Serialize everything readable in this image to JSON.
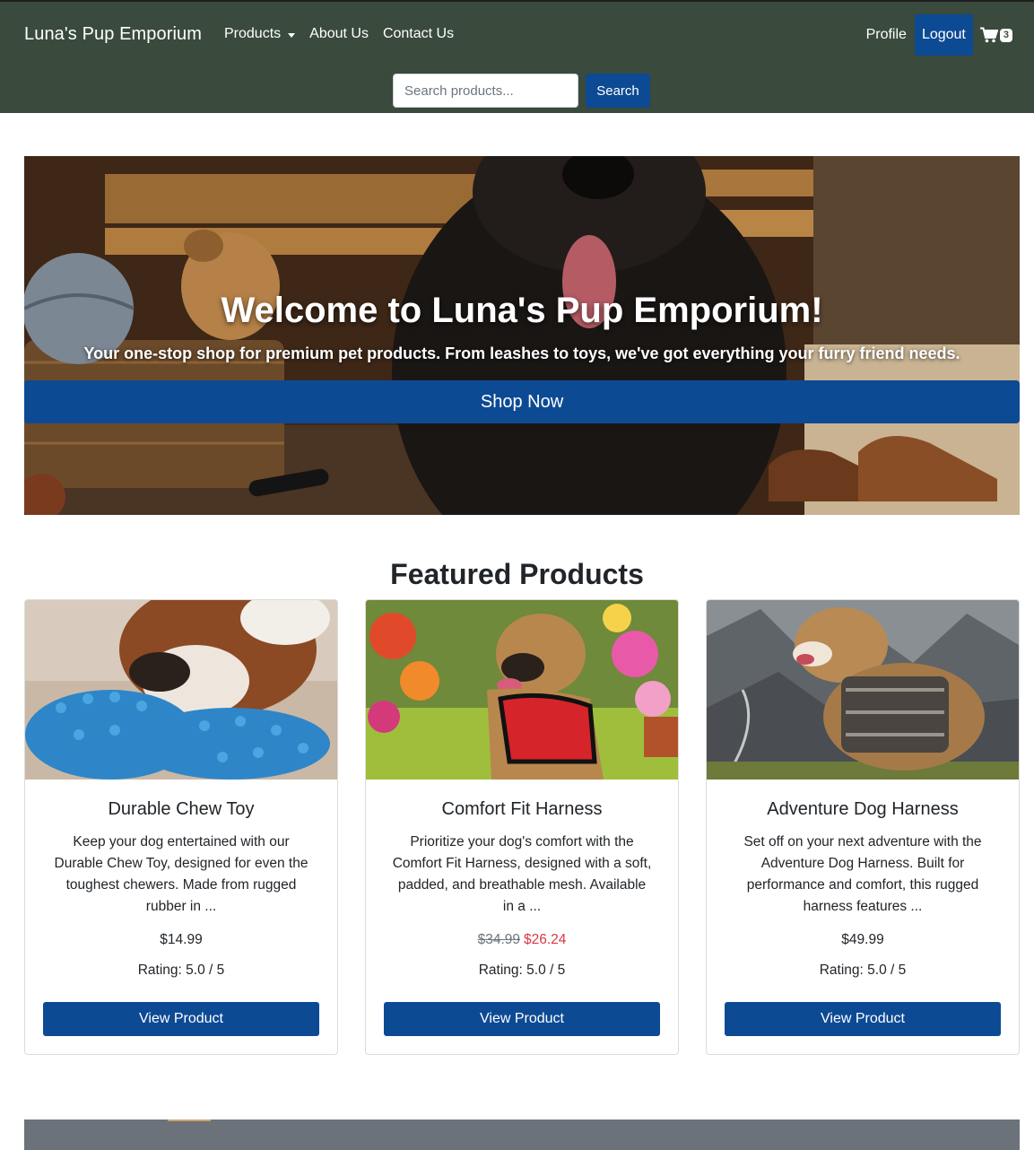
{
  "navbar": {
    "brand": "Luna's Pup Emporium",
    "links": [
      "Products",
      "About Us",
      "Contact Us"
    ],
    "profile_label": "Profile",
    "logout_label": "Logout",
    "cart_count": "3",
    "search_placeholder": "Search products...",
    "search_button": "Search"
  },
  "hero": {
    "title": "Welcome to Luna's Pup Emporium!",
    "subtitle": "Your one-stop shop for premium pet products. From leashes to toys, we've got everything your furry friend needs.",
    "cta_label": "Shop Now"
  },
  "featured": {
    "title": "Featured Products",
    "products": [
      {
        "name": "Durable Chew Toy",
        "description": "Keep your dog entertained with our Durable Chew Toy, designed for even the toughest chewers. Made from rugged rubber in ...",
        "price": "$14.99",
        "rating": "Rating: 5.0 / 5",
        "button": "View Product"
      },
      {
        "name": "Comfort Fit Harness",
        "description": "Prioritize your dog's comfort with the Comfort Fit Harness, designed with a soft, padded, and breathable mesh. Available in a ...",
        "price_old": "$34.99",
        "price_new": "$26.24",
        "rating": "Rating: 5.0 / 5",
        "button": "View Product"
      },
      {
        "name": "Adventure Dog Harness",
        "description": "Set off on your next adventure with the Adventure Dog Harness. Built for performance and comfort, this rugged harness features ...",
        "price": "$49.99",
        "rating": "Rating: 5.0 / 5",
        "button": "View Product"
      }
    ]
  },
  "colors": {
    "navbar_bg": "#3a4a3d",
    "primary": "#0d4a94",
    "sale_price": "#dc3545"
  }
}
